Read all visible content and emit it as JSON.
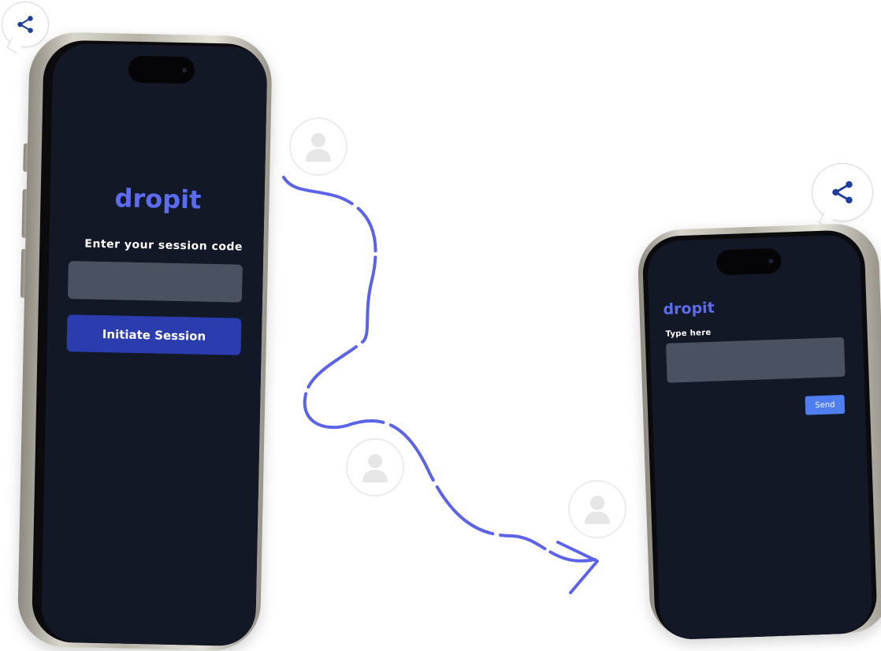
{
  "left_phone": {
    "brand": "dropit",
    "prompt": "Enter your session code",
    "code_input_value": "",
    "button_label": "Initiate Session"
  },
  "right_phone": {
    "brand": "dropit",
    "prompt": "Type here",
    "message_input_value": "",
    "button_label": "Send"
  },
  "icons": {
    "share": "share-icon",
    "user": "user-avatar-icon",
    "connector": "dashed-curved-arrow"
  },
  "colors": {
    "brand": "#5b6cf0",
    "primary_button": "#2a3cae",
    "send_button": "#4f7ef0",
    "screen_bg": "#121826",
    "input_bg": "#4a5161",
    "share_icon": "#1f3f9f",
    "arrow": "#5b63e8"
  }
}
